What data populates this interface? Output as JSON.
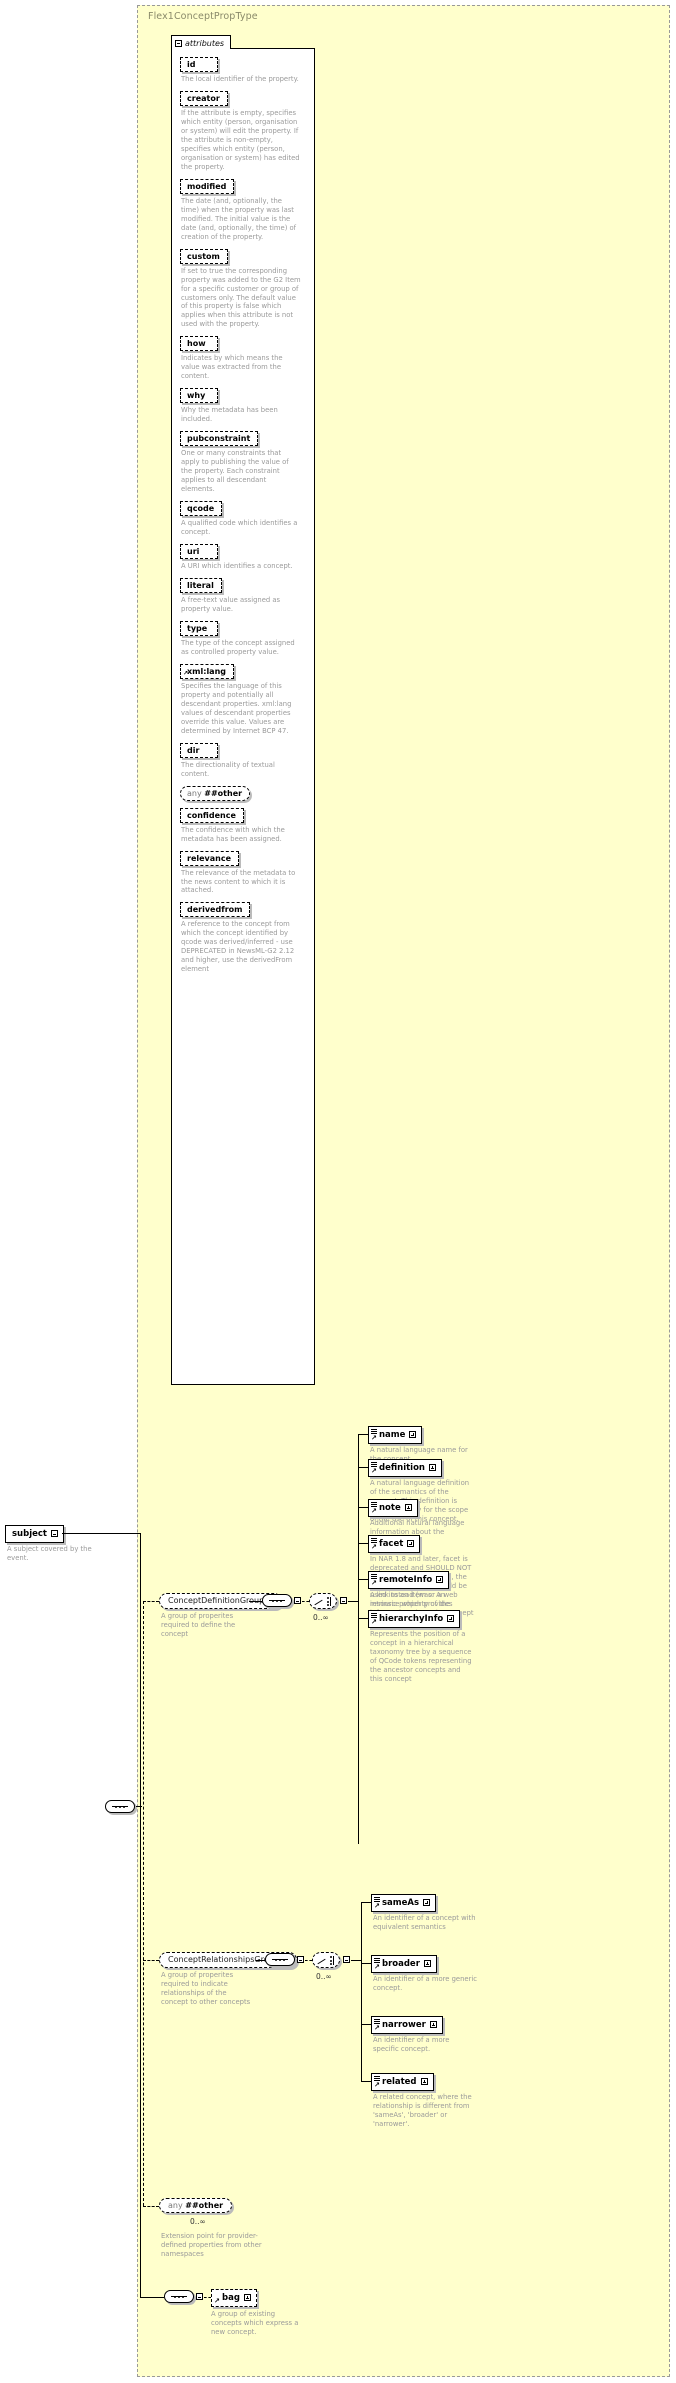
{
  "type": {
    "name": "Flex1ConceptPropType"
  },
  "attributes_panel": {
    "tab_label": "attributes",
    "toggle": "minus",
    "items": [
      {
        "name": "id",
        "doc": "The local identifier of the property."
      },
      {
        "name": "creator",
        "doc": "If the attribute is empty, specifies which entity (person, organisation or system) will edit the property. If the attribute is non-empty, specifies which entity (person, organisation or system) has edited the property."
      },
      {
        "name": "modified",
        "doc": "The date (and, optionally, the time) when the property was last modified. The initial value is the date (and, optionally, the time) of creation of the property."
      },
      {
        "name": "custom",
        "doc": "If set to true the corresponding property was added to the G2 Item for a specific customer or group of customers only. The default value of this property is false which applies when this attribute is not used with the property."
      },
      {
        "name": "how",
        "doc": "Indicates by which means the value was extracted from the content."
      },
      {
        "name": "why",
        "doc": "Why the metadata has been included."
      },
      {
        "name": "pubconstraint",
        "doc": "One or many constraints that apply to publishing the value of the property. Each constraint applies to all descendant elements."
      },
      {
        "name": "qcode",
        "doc": "A qualified code which identifies a concept."
      },
      {
        "name": "uri",
        "doc": "A URI which identifies a concept."
      },
      {
        "name": "literal",
        "doc": "A free-text value assigned as property value."
      },
      {
        "name": "type",
        "doc": "The type of the concept assigned as controlled property value."
      },
      {
        "name": "xml:lang",
        "doc": "Specifies the language of this property and potentially all descendant properties. xml:lang values of descendant properties override this value. Values are determined by Internet BCP 47."
      },
      {
        "name": "dir",
        "doc": "The directionality of textual content."
      },
      {
        "name": "any ##other",
        "doc": "",
        "shape": "round",
        "any_prefix": "any",
        "any_value": "##other"
      },
      {
        "name": "confidence",
        "doc": "The confidence with which the metadata has been assigned."
      },
      {
        "name": "relevance",
        "doc": "The relevance of the metadata to the news content to which it is attached."
      },
      {
        "name": "derivedfrom",
        "doc": "A reference to the concept from which the concept identified by qcode was derived/inferred - use DEPRECATED in NewsML-G2 2.12 and higher, use the derivedFrom element"
      }
    ]
  },
  "subject": {
    "label": "subject",
    "toggle": "minus",
    "doc": "A subject covered by the event."
  },
  "groups": {
    "concept_definition": {
      "label": "ConceptDefinitionGroup",
      "toggle": "minus",
      "doc": "A group of properites required to define the concept",
      "occurrence": "0..∞",
      "elements": [
        {
          "label": "name",
          "toggle": "plus",
          "doc": "A natural language name for the concept."
        },
        {
          "label": "definition",
          "toggle": "plus",
          "doc": "A natural language definition of the semantics of the concept. This definition is normative only for the scope of the use of this concept."
        },
        {
          "label": "note",
          "toggle": "plus",
          "doc": "Additional natural language information about the concept."
        },
        {
          "label": "facet",
          "toggle": "plus",
          "doc": "In NAR 1.8 and later, facet is deprecated and SHOULD NOT (see RFC 2119) be used, the \"related\" property should be used instead (was: An intrinsic property of the concept.)"
        },
        {
          "label": "remoteInfo",
          "toggle": "plus",
          "doc": "A link to an item or a web resource which provides information about the concept"
        },
        {
          "label": "hierarchyInfo",
          "toggle": "plus",
          "doc": "Represents the position of a concept in a hierarchical taxonomy tree by a sequence of QCode tokens representing the ancestor concepts and this concept"
        }
      ]
    },
    "concept_relationships": {
      "label": "ConceptRelationshipsGroup",
      "toggle": "minus",
      "doc": "A group of properites required to indicate relationships of the concept to other concepts",
      "occurrence": "0..∞",
      "elements": [
        {
          "label": "sameAs",
          "toggle": "plus",
          "doc": "An identifier of a concept with equivalent semantics"
        },
        {
          "label": "broader",
          "toggle": "plus",
          "doc": "An identifier of a more generic concept."
        },
        {
          "label": "narrower",
          "toggle": "plus",
          "doc": "An identifier of a more specific concept."
        },
        {
          "label": "related",
          "toggle": "plus",
          "doc": "A related concept, where the relationship is different from 'sameAs', 'broader' or 'narrower'."
        }
      ]
    }
  },
  "any_other": {
    "prefix": "any",
    "value": "##other",
    "occurrence": "0..∞",
    "doc": "Extension point for provider-defined properties from other namespaces"
  },
  "bag": {
    "label": "bag",
    "toggle": "plus",
    "doc": "A group of existing concepts which express a new concept."
  }
}
